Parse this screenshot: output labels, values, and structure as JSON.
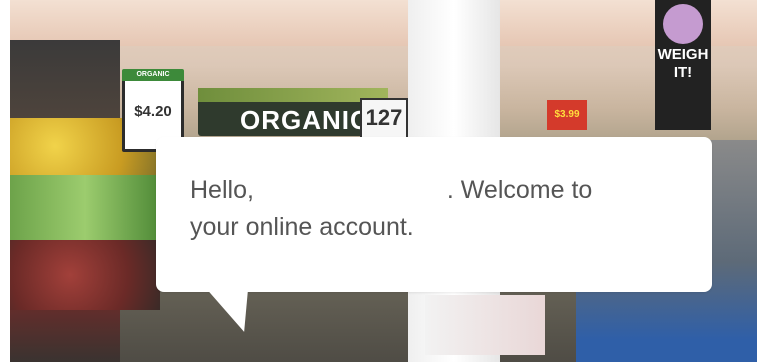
{
  "signage": {
    "organics_label": "ORGANICS",
    "organics_number": "127",
    "price_tag_header": "ORGANIC",
    "price_tag_value": "$4.20",
    "weigh_line1": "WEIGH",
    "weigh_line2": "IT!",
    "red_sign_price": "$3.99"
  },
  "welcome": {
    "greeting": "Hello,",
    "user_name": "",
    "line_suffix": ". Welcome to",
    "line2": "your online account."
  }
}
